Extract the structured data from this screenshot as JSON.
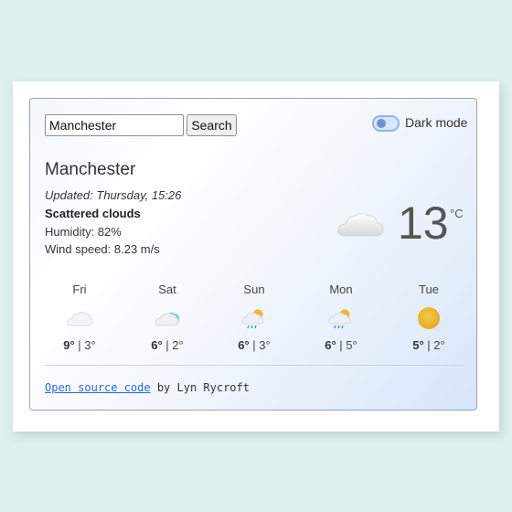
{
  "search": {
    "value": "Manchester",
    "button_label": "Search"
  },
  "dark_mode": {
    "label": "Dark mode",
    "enabled": false
  },
  "current": {
    "city": "Manchester",
    "updated": "Updated: Thursday, 15:26",
    "description": "Scattered clouds",
    "humidity": "Humidity: 82%",
    "wind": "Wind speed: 8.23 m/s",
    "temperature": "13",
    "unit": "°C",
    "icon": "cloud-icon"
  },
  "forecast": [
    {
      "day": "Fri",
      "high": "9°",
      "low": "3°",
      "icon": "cloud-icon"
    },
    {
      "day": "Sat",
      "high": "6°",
      "low": "2°",
      "icon": "broken-clouds-icon"
    },
    {
      "day": "Sun",
      "high": "6°",
      "low": "3°",
      "icon": "rain-sun-icon"
    },
    {
      "day": "Mon",
      "high": "6°",
      "low": "5°",
      "icon": "rain-sun-icon"
    },
    {
      "day": "Tue",
      "high": "5°",
      "low": "2°",
      "icon": "sun-icon"
    }
  ],
  "footer": {
    "link_text": "Open source code",
    "credit": " by Lyn Rycroft"
  }
}
